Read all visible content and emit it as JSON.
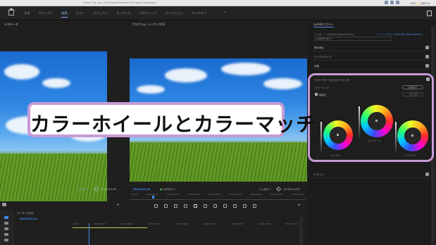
{
  "titlebar": {
    "path": "/Users/_Fuji_mac_2019/Dropbox/Premiere Pro/Project/Lumetri.prproj",
    "status": "100%  ⚡  近時 3:02"
  },
  "workspaces": {
    "tabs": [
      "学習",
      "アセンブリ",
      "編集",
      "カラー",
      "エフェクト",
      "オーディオ",
      "グラフィック",
      "キャプション",
      "ライブラリ"
    ],
    "active_index": 2,
    "more": "»"
  },
  "source": {
    "title": "メタデータ",
    "zoom": "フル画質",
    "timecode": "00;00;10;00"
  },
  "program": {
    "title": "プログラム: シーケンス01",
    "timecode": "00;00;02;10",
    "fit": "全体表示",
    "zoom": "フル画質",
    "duration": "00;00;10;00",
    "ruler": [
      "00;00",
      "00;00;02;00",
      "00;00;04;00",
      "00;00;06;00",
      "00;00;08;00",
      "00;00;10;00",
      "00;00;12;00",
      "00;00;14;00",
      "00;00;16;00"
    ]
  },
  "lumetri": {
    "title": "Lumetri カラー",
    "master_line": "マスター * 1645465_WaterdfaImo..",
    "link_line": "シーケンス01 * 1645465_WaterdfaImo..",
    "preset": "Lumetri カラー",
    "sections": [
      "基本補正",
      "クリエイティブ",
      "曲線"
    ],
    "vignette": "ビネット",
    "wheels": {
      "title": "カラーホイールとカラーマッチ",
      "match_label": "カラーマッチ",
      "compare_btn": "比較表示",
      "apply_btn": "一致を適用",
      "face_detect": "顔検出",
      "shadow": "シャドウ",
      "midtone": "ミッドトーン",
      "highlight": "ハイライト"
    }
  },
  "sequence": {
    "title": "シーケンス01",
    "timecode": "00;00;02;10",
    "ruler": [
      "00;00",
      "00;00;04;00",
      "00;00;08;00",
      "00;00;12;00",
      "00;00;16;00",
      "00;00;20;00",
      "00;00;24;00",
      "00;00;28;00",
      "00;00;32;00"
    ]
  },
  "callout": {
    "text": "カラーホイールとカラーマッチ"
  },
  "colors": {
    "accent": "#3f8cf0",
    "highlight_frame": "#c89ad6",
    "timecode_green": "#3dbf5a"
  }
}
